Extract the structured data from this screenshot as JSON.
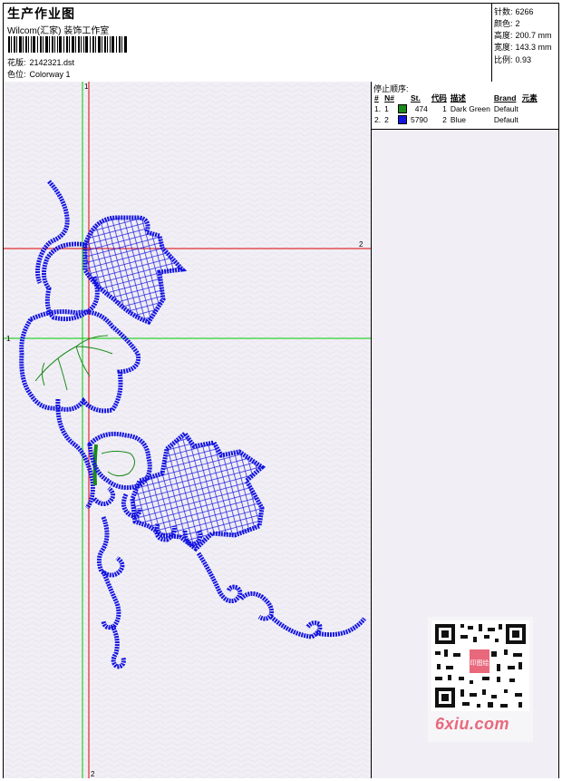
{
  "header": {
    "title": "生产作业图",
    "studio": "Wilcom(汇家) 装饰工作室",
    "design_label": "花版:",
    "design_value": "2142321.dst",
    "colorway_label": "色位:",
    "colorway_value": "Colorway 1"
  },
  "stats": [
    {
      "label": "针数:",
      "value": "6266"
    },
    {
      "label": "颜色:",
      "value": "2"
    },
    {
      "label": "高度:",
      "value": "200.7 mm"
    },
    {
      "label": "宽度:",
      "value": "143.3 mm"
    },
    {
      "label": "比例:",
      "value": "0.93"
    }
  ],
  "stop_sequence": {
    "title": "停止顺序:",
    "columns": [
      "#",
      "N#",
      "St.",
      "代码",
      "描述",
      "Brand",
      "元素"
    ],
    "rows": [
      {
        "index": "1.",
        "n": "1",
        "color": "#1a8a1a",
        "stitches": "474",
        "code": "1",
        "description": "Dark Green",
        "brand": "Default"
      },
      {
        "index": "2.",
        "n": "2",
        "color": "#1414e0",
        "stitches": "5790",
        "code": "2",
        "description": "Blue",
        "brand": "Default"
      }
    ]
  },
  "guides": {
    "green_label": "1",
    "red_label": "2",
    "green_color": "#00c800",
    "red_color": "#e00000"
  },
  "watermark": {
    "site": "6xiu.com",
    "stamp_text": "印图绘"
  },
  "colors": {
    "canvas_bg": "#f1eff5",
    "thread_blue": "#1414e0",
    "thread_green": "#1a8a1a"
  }
}
